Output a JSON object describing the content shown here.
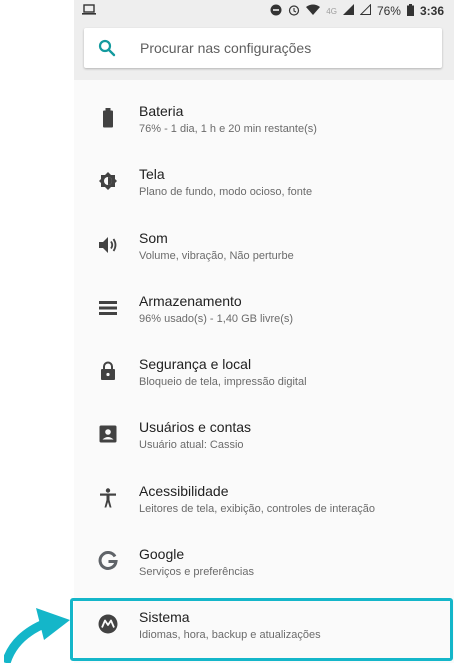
{
  "status": {
    "network": "4G",
    "battery": "76%",
    "time": "3:36"
  },
  "search": {
    "placeholder": "Procurar nas configurações"
  },
  "items": [
    {
      "title": "Bateria",
      "subtitle": "76% - 1 dia, 1 h e 20 min restante(s)",
      "icon": "battery-icon"
    },
    {
      "title": "Tela",
      "subtitle": "Plano de fundo, modo ocioso, fonte",
      "icon": "brightness-icon"
    },
    {
      "title": "Som",
      "subtitle": "Volume, vibração, Não perturbe",
      "icon": "volume-icon"
    },
    {
      "title": "Armazenamento",
      "subtitle": "96% usado(s) - 1,40 GB livre(s)",
      "icon": "storage-icon"
    },
    {
      "title": "Segurança e local",
      "subtitle": "Bloqueio de tela, impressão digital",
      "icon": "lock-icon"
    },
    {
      "title": "Usuários e contas",
      "subtitle": "Usuário atual: Cassio",
      "icon": "account-icon"
    },
    {
      "title": "Acessibilidade",
      "subtitle": "Leitores de tela, exibição, controles de interação",
      "icon": "accessibility-icon"
    },
    {
      "title": "Google",
      "subtitle": "Serviços e preferências",
      "icon": "google-icon"
    },
    {
      "title": "Sistema",
      "subtitle": "Idiomas, hora, backup e atualizações",
      "icon": "motorola-icon"
    }
  ],
  "colors": {
    "highlight": "#14b6c9",
    "icon": "#424242",
    "google": "#5f6368",
    "search_icon": "#139a9e"
  }
}
